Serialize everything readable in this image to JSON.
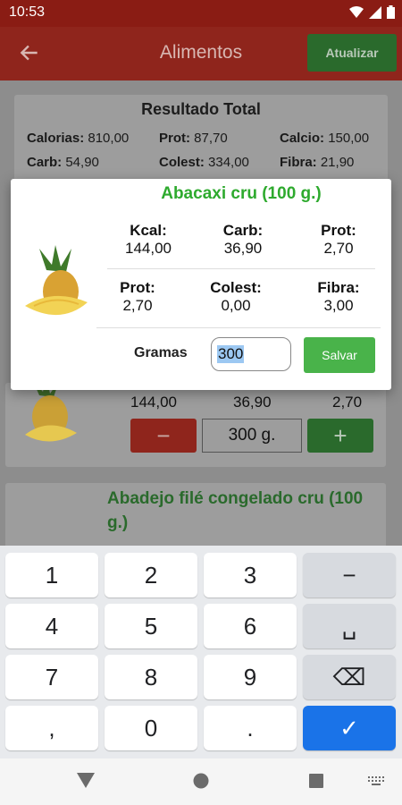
{
  "status": {
    "time": "10:53"
  },
  "appbar": {
    "title": "Alimentos",
    "update_label": "Atualizar"
  },
  "total": {
    "title": "Resultado Total",
    "rows": [
      [
        {
          "label": "Calorias:",
          "value": "810,00"
        },
        {
          "label": "Prot:",
          "value": "87,70"
        },
        {
          "label": "Calcio:",
          "value": "150,00"
        }
      ],
      [
        {
          "label": "Carb:",
          "value": "54,90"
        },
        {
          "label": "Colest:",
          "value": "334,00"
        },
        {
          "label": "Fibra:",
          "value": "21,90"
        }
      ]
    ]
  },
  "food_card": {
    "values": [
      "144,00",
      "36,90",
      "2,70"
    ],
    "quantity": "300 g.",
    "minus": "−",
    "plus": "+"
  },
  "food_card2": {
    "title": "Abadejo filé congelado cru (100 g.)"
  },
  "dialog": {
    "title": "Abacaxi cru (100 g.)",
    "row1": [
      {
        "label": "Kcal:",
        "value": "144,00"
      },
      {
        "label": "Carb:",
        "value": "36,90"
      },
      {
        "label": "Prot:",
        "value": "2,70"
      }
    ],
    "row2": [
      {
        "label": "Prot:",
        "value": "2,70"
      },
      {
        "label": "Colest:",
        "value": "0,00"
      },
      {
        "label": "Fibra:",
        "value": "3,00"
      }
    ],
    "gramas_label": "Gramas",
    "gramas_value": "300",
    "save_label": "Salvar"
  },
  "keyboard": {
    "rows": [
      [
        "1",
        "2",
        "3",
        "−"
      ],
      [
        "4",
        "5",
        "6",
        "␣"
      ],
      [
        "7",
        "8",
        "9",
        "⌫"
      ],
      [
        ",",
        "0",
        ".",
        "✓"
      ]
    ]
  }
}
